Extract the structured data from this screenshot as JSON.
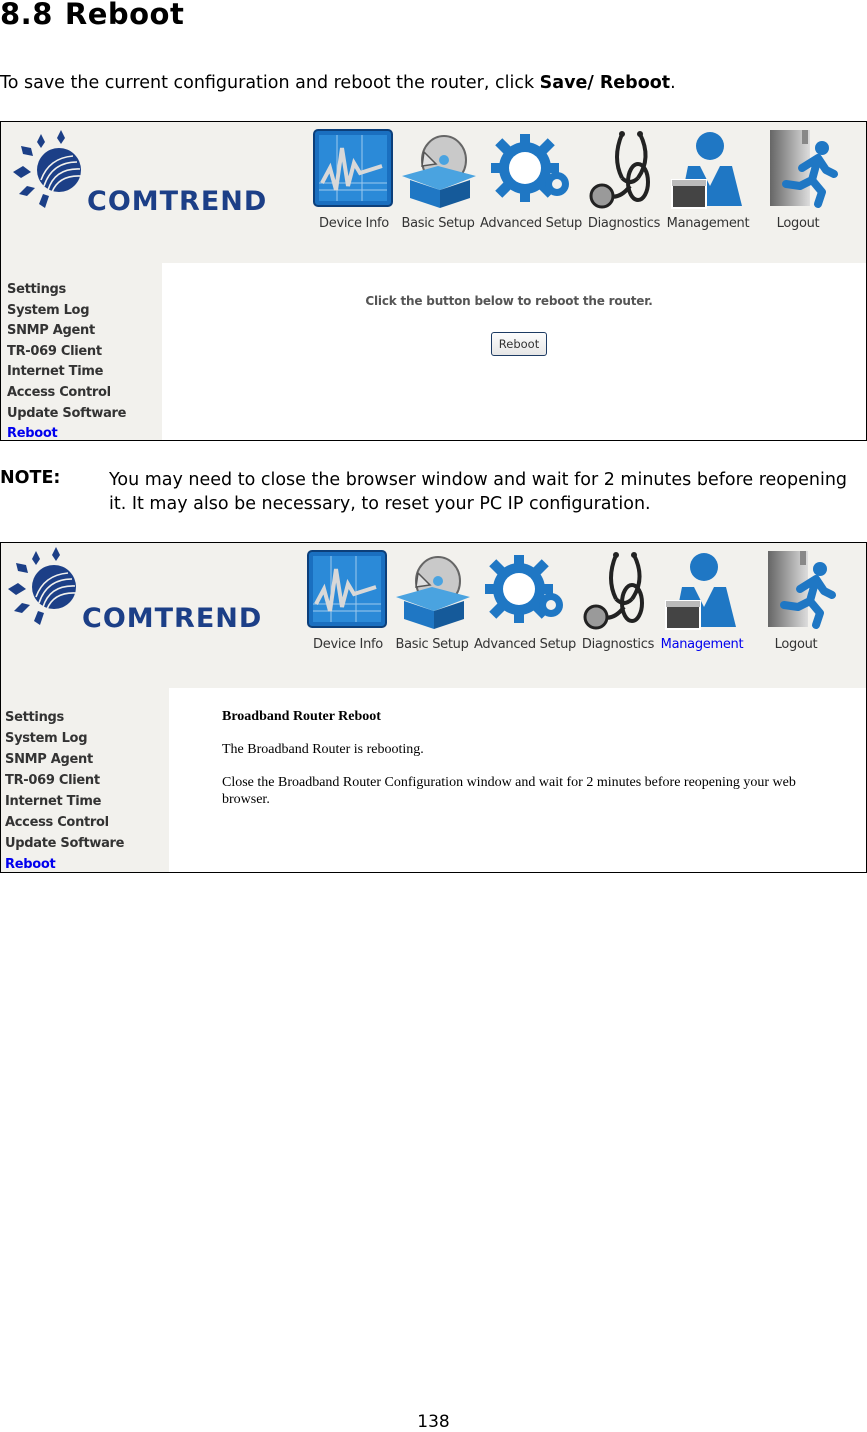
{
  "heading": {
    "number": "8.8",
    "title": "Reboot"
  },
  "intro": {
    "text": "To save the current configuration and reboot the router, click ",
    "bold": "Save/ Reboot",
    "suffix": "."
  },
  "brand": {
    "name": "COMTREND",
    "color": "#1c3f87"
  },
  "nav": {
    "items": [
      {
        "label": "Device Info",
        "icon": "device-info-icon"
      },
      {
        "label": "Basic Setup",
        "icon": "basic-setup-icon"
      },
      {
        "label": "Advanced Setup",
        "icon": "advanced-setup-icon"
      },
      {
        "label": "Diagnostics",
        "icon": "stethoscope-icon"
      },
      {
        "label": "Management",
        "icon": "management-icon"
      },
      {
        "label": "Logout",
        "icon": "logout-icon"
      }
    ]
  },
  "sidebar": {
    "items": [
      "Settings",
      "System Log",
      "SNMP Agent",
      "TR-069 Client",
      "Internet Time",
      "Access Control",
      "Update Software",
      "Reboot"
    ],
    "active": "Reboot",
    "active_color": "#0000ee"
  },
  "screen1": {
    "instruction": "Click the button below to reboot the router.",
    "button_label": "Reboot"
  },
  "note": {
    "label": "NOTE:",
    "text": "You may need to close the browser window and wait for 2 minutes before reopening it. It may also be necessary, to reset your PC IP configuration."
  },
  "screen2": {
    "title": "Broadband Router Reboot",
    "status": "The Broadband Router is rebooting.",
    "message": "Close the Broadband Router Configuration window and wait for 2 minutes before reopening your web browser.",
    "active_nav": "Management"
  },
  "page_number": "138"
}
